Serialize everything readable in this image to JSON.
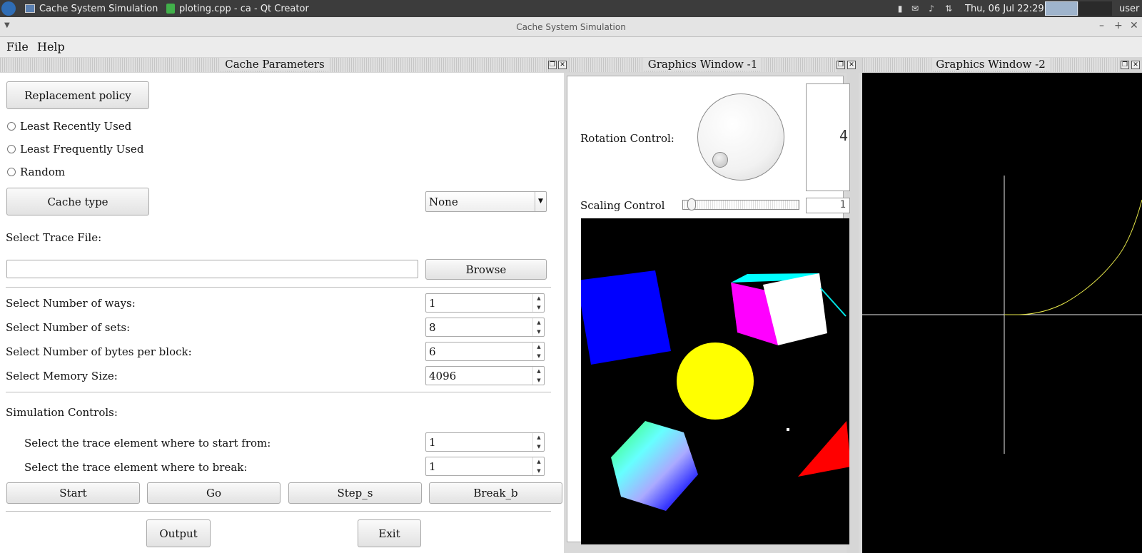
{
  "taskbar": {
    "items": [
      "Cache System Simulation",
      "ploting.cpp - ca - Qt Creator"
    ],
    "datetime": "Thu, 06 Jul  22:29",
    "user": "user"
  },
  "window": {
    "title": "Cache System Simulation"
  },
  "menu": {
    "file": "File",
    "help": "Help"
  },
  "cache_params": {
    "title": "Cache Parameters",
    "replacement_button": "Replacement policy",
    "policies": [
      "Least Recently Used",
      "Least Frequently Used",
      "Random"
    ],
    "cache_type_button": "Cache type",
    "cache_type_value": "None",
    "trace_label": "Select Trace File:",
    "trace_value": "",
    "browse": "Browse",
    "ways_label": "Select Number of ways:",
    "ways_value": "1",
    "sets_label": "Select Number of sets:",
    "sets_value": "8",
    "bytes_label": "Select Number of bytes per block:",
    "bytes_value": "6",
    "memory_label": "Select Memory Size:",
    "memory_value": "4096",
    "sim_label": "Simulation Controls:",
    "start_from_label": "Select the trace element where to start from:",
    "start_from_value": "1",
    "break_label": "Select the trace element where to break:",
    "break_value": "1",
    "start": "Start",
    "go": "Go",
    "step": "Step_s",
    "break": "Break_b",
    "output": "Output",
    "exit": "Exit"
  },
  "graphics1": {
    "title": "Graphics Window -1",
    "rotation_label": "Rotation Control:",
    "rotation_value": "4",
    "scaling_label": "Scaling Control",
    "scaling_value": "1"
  },
  "graphics2": {
    "title": "Graphics Window -2"
  },
  "colors": {
    "canvas_bg": "#000000",
    "square": "#0000ff",
    "circle": "#ffff00",
    "triangle": "#ff0000",
    "curve": "#e6e64a"
  }
}
